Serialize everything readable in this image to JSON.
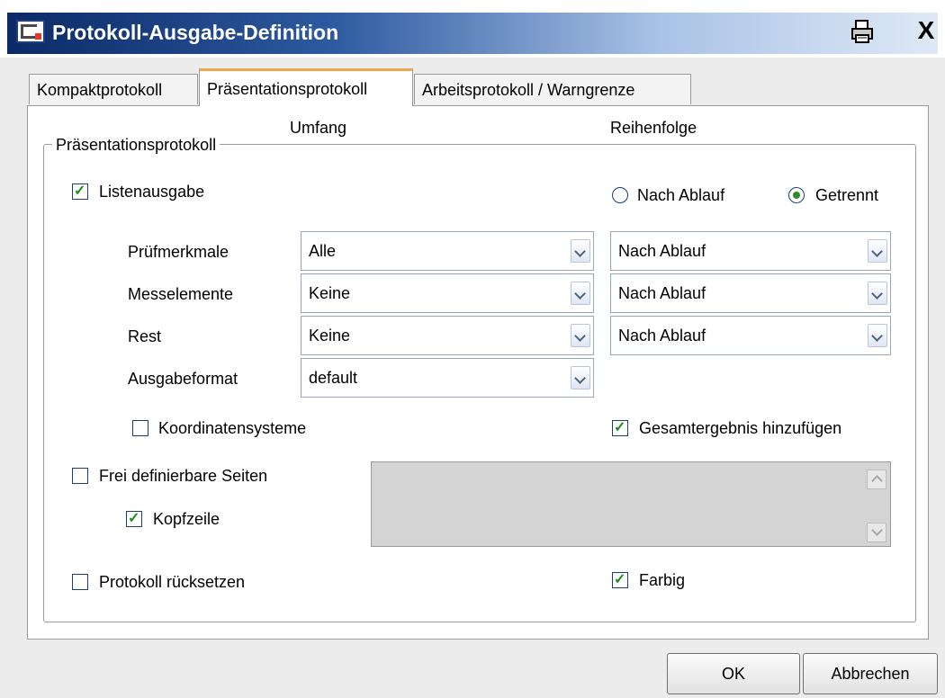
{
  "window": {
    "title": "Protokoll-Ausgabe-Definition",
    "print_icon": "printer-icon",
    "close_label": "X"
  },
  "tabs": [
    {
      "label": "Kompaktprotokoll",
      "active": false
    },
    {
      "label": "Präsentationsprotokoll",
      "active": true
    },
    {
      "label": "Arbeitsprotokoll / Warngrenze",
      "active": false
    }
  ],
  "group": {
    "legend": "Präsentationsprotokoll",
    "col_umfang": "Umfang",
    "col_reihenfolge": "Reihenfolge"
  },
  "listenausgabe": {
    "label": "Listenausgabe",
    "checked": true
  },
  "order_mode": {
    "options": [
      "Nach Ablauf",
      "Getrennt"
    ],
    "selected": "Getrennt"
  },
  "rows": [
    {
      "label": "Prüfmerkmale",
      "umfang": "Alle",
      "reihenfolge": "Nach Ablauf"
    },
    {
      "label": "Messelemente",
      "umfang": "Keine",
      "reihenfolge": "Nach Ablauf"
    },
    {
      "label": "Rest",
      "umfang": "Keine",
      "reihenfolge": "Nach Ablauf"
    },
    {
      "label": "Ausgabeformat",
      "umfang": "default"
    }
  ],
  "koordinatensysteme": {
    "label": "Koordinatensysteme",
    "checked": false
  },
  "gesamtergebnis": {
    "label": "Gesamtergebnis hinzufügen",
    "checked": true
  },
  "frei_definierbare": {
    "label": "Frei definierbare Seiten",
    "checked": false
  },
  "kopfzeile": {
    "label": "Kopfzeile",
    "checked": true
  },
  "protokoll_ruecksetzen": {
    "label": "Protokoll rücksetzen",
    "checked": false
  },
  "farbig": {
    "label": "Farbig",
    "checked": true
  },
  "buttons": {
    "ok": "OK",
    "cancel": "Abbrechen"
  },
  "colors": {
    "title_gradient_start": "#0b2a66",
    "tab_active_accent": "#f0a94a",
    "check_green": "#1f8a22"
  }
}
